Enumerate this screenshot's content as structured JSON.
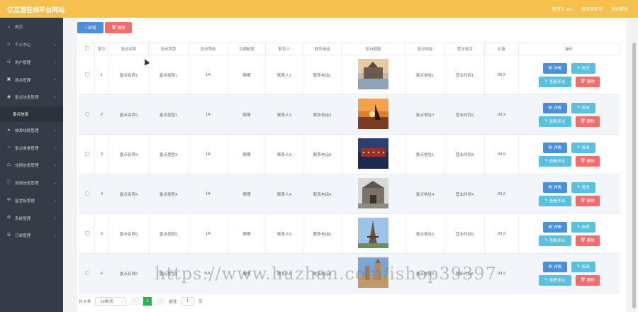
{
  "header": {
    "title": "亿互游在线平台网站",
    "user_label": "管理员 abo",
    "front_label": "退出到前台",
    "logout_label": "退出登录"
  },
  "sidebar": {
    "items": [
      {
        "label": "首页",
        "icon": "home-icon"
      },
      {
        "label": "个人中心",
        "icon": "user-icon"
      },
      {
        "label": "用户管理",
        "icon": "users-icon"
      },
      {
        "label": "商台管理",
        "icon": "shop-icon"
      },
      {
        "label": "景点信息管理",
        "icon": "location-icon"
      },
      {
        "label": "景点信息",
        "icon": "",
        "sub": true
      },
      {
        "label": "旅游线路管理",
        "icon": "route-icon"
      },
      {
        "label": "景点美食管理",
        "icon": "food-icon"
      },
      {
        "label": "住宿信息管理",
        "icon": "hotel-icon"
      },
      {
        "label": "旅游信息管理",
        "icon": "info-icon"
      },
      {
        "label": "留言板管理",
        "icon": "message-icon"
      },
      {
        "label": "系统管理",
        "icon": "settings-icon"
      },
      {
        "label": "订单管理",
        "icon": "order-icon"
      }
    ]
  },
  "toolbar": {
    "add_label": "+ 新增",
    "delete_label": "删除"
  },
  "table": {
    "headers": [
      "索引",
      "景点名称",
      "景点类型",
      "景点等级",
      "交通制图",
      "联系人",
      "联系电话",
      "景点剧图",
      "景点地址",
      "营业时间",
      "价格",
      "操作"
    ],
    "rows": [
      {
        "idx": "1",
        "name": "景点名称1",
        "type": "景点类型1",
        "level": "1A",
        "traffic": "哪哪",
        "contact": "联系人1",
        "phone": "联系电话1",
        "address": "景点地址1",
        "hours": "营业时间1",
        "price": "99.9"
      },
      {
        "idx": "2",
        "name": "景点名称2",
        "type": "景点类型2",
        "level": "1A",
        "traffic": "哪哪",
        "contact": "联系人2",
        "phone": "联系电话2",
        "address": "景点地址2",
        "hours": "营业时间2",
        "price": "99.9"
      },
      {
        "idx": "3",
        "name": "景点名称3",
        "type": "景点类型3",
        "level": "1A",
        "traffic": "哪哪",
        "contact": "联系人3",
        "phone": "联系电话3",
        "address": "景点地址1",
        "hours": "营业时间3",
        "price": "99.9"
      },
      {
        "idx": "4",
        "name": "景点名称4",
        "type": "景点类型4",
        "level": "1A",
        "traffic": "哪哪",
        "contact": "联系人4",
        "phone": "联系电话4",
        "address": "景点地址4",
        "hours": "营业时间4",
        "price": "99.9"
      },
      {
        "idx": "5",
        "name": "景点名称5",
        "type": "景点类型5",
        "level": "1A",
        "traffic": "哪哪",
        "contact": "联系人5",
        "phone": "联系电话5",
        "address": "景点地址5",
        "hours": "营业时间5",
        "price": "99.9"
      },
      {
        "idx": "6",
        "name": "景点名称6",
        "type": "景点类型6",
        "level": "1A",
        "traffic": "哪哪",
        "contact": "联系人6",
        "phone": "联系电话6",
        "address": "景点地址6",
        "hours": "营业时间6",
        "price": "99.9"
      }
    ],
    "ops": {
      "detail": "详情",
      "edit": "修改",
      "comment": "查看评论",
      "remove": "删除"
    }
  },
  "pagination": {
    "total": "共 6 条",
    "page_size": "10条/页",
    "current": "1",
    "goto_label": "前往",
    "goto_value": "1",
    "page_suffix": "页"
  },
  "watermark": "https://www.huzhan.com/ishop39397",
  "colors": {
    "header": "#f5c04d",
    "sidebar": "#353c48",
    "primary": "#4a90d9",
    "info": "#5bc0de",
    "danger": "#f56c6c",
    "success": "#2cae53"
  }
}
